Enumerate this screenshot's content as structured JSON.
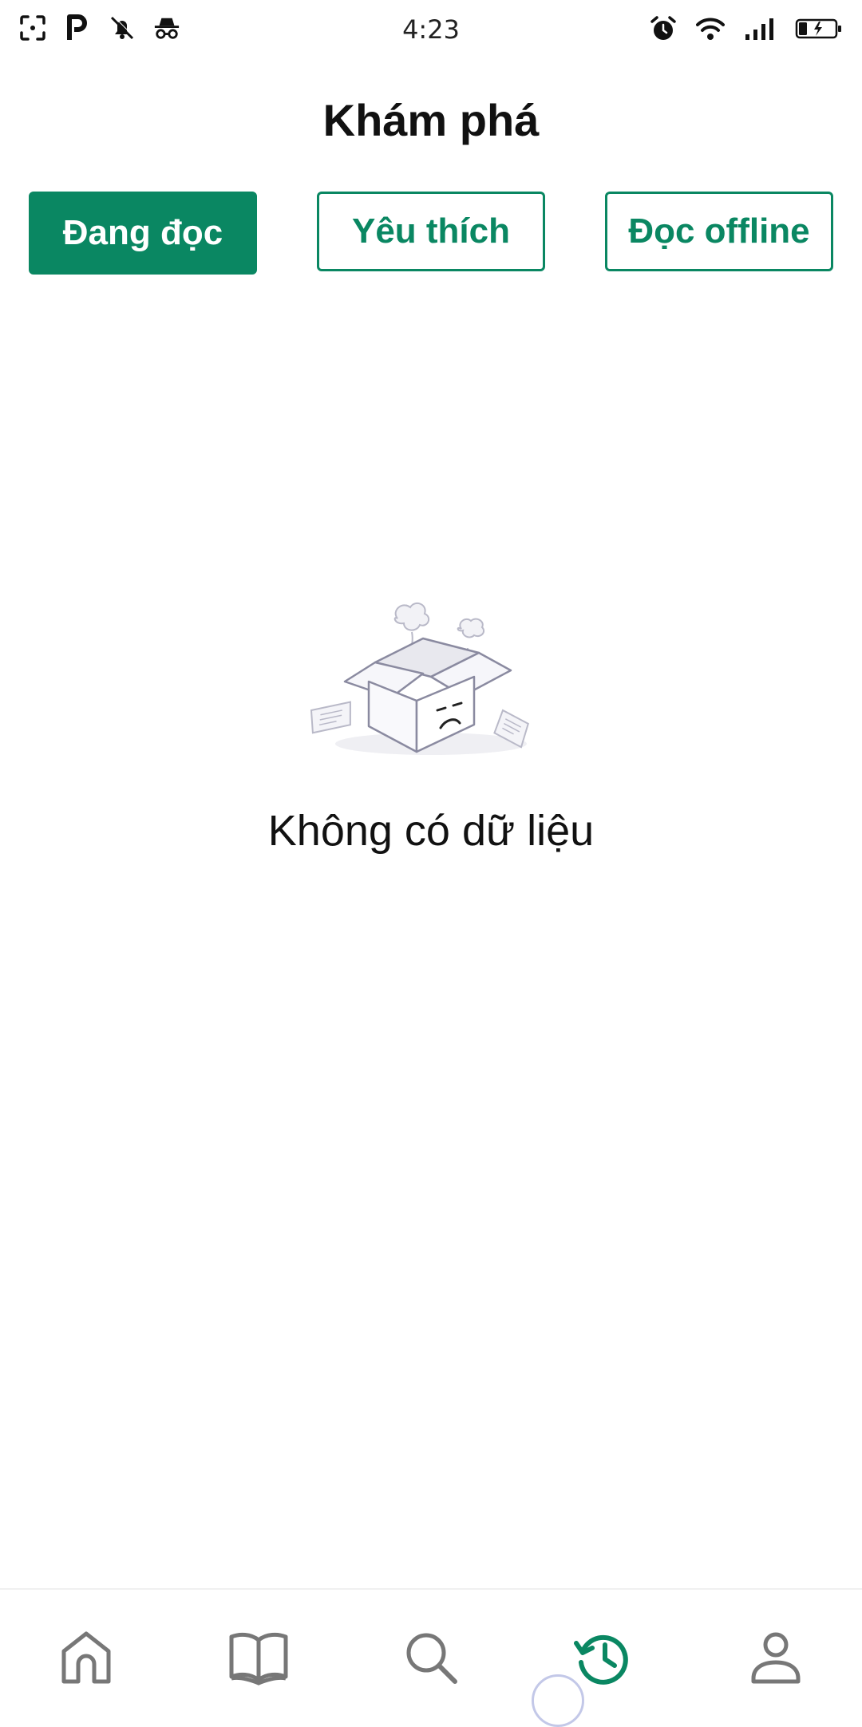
{
  "status_bar": {
    "time": "4:23",
    "left_icons": [
      "screenshot-icon",
      "parking-icon",
      "bell-off-icon",
      "incognito-icon"
    ],
    "right_icons": [
      "alarm-icon",
      "wifi-icon",
      "signal-icon",
      "battery-charging-icon"
    ]
  },
  "header": {
    "title": "Khám phá"
  },
  "tabs": [
    {
      "label": "Đang đọc",
      "active": true
    },
    {
      "label": "Yêu thích",
      "active": false
    },
    {
      "label": "Đọc offline",
      "active": false
    }
  ],
  "empty_state": {
    "message": "Không có dữ liệu",
    "icon": "empty-box-icon"
  },
  "bottom_nav": {
    "items": [
      {
        "icon": "home-icon",
        "active": false
      },
      {
        "icon": "book-icon",
        "active": false
      },
      {
        "icon": "search-icon",
        "active": false
      },
      {
        "icon": "history-icon",
        "active": true
      },
      {
        "icon": "user-icon",
        "active": false
      }
    ]
  },
  "colors": {
    "accent": "#0a8762",
    "nav_inactive": "#777777",
    "text": "#111111"
  }
}
